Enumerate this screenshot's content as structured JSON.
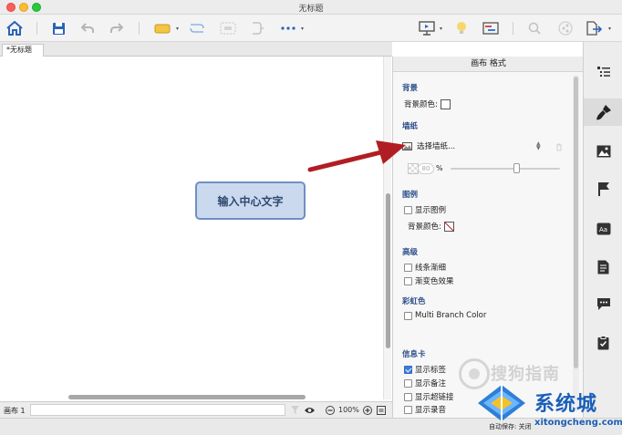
{
  "window": {
    "title": "无标题"
  },
  "document_tab": {
    "label": "*无标题"
  },
  "central_topic": {
    "text": "输入中心文字"
  },
  "statusbar": {
    "sheet_label": "画布 1",
    "zoom": "100%"
  },
  "format_panel": {
    "title": "画布 格式",
    "background": {
      "heading": "背景",
      "color_label": "背景颜色:"
    },
    "wallpaper": {
      "heading": "墙纸",
      "select_label": "选择墙纸...",
      "opacity_value": "80",
      "opacity_unit": "%",
      "opacity_fraction": 0.6
    },
    "legend": {
      "heading": "图例",
      "show_legend": "显示图例",
      "show_legend_checked": false,
      "bg_color_label": "背景颜色:"
    },
    "advanced": {
      "heading": "高级",
      "taper_lines": "线条渐细",
      "taper_lines_checked": false,
      "gradient": "渐变色效果",
      "gradient_checked": false
    },
    "rainbow": {
      "heading": "彩虹色",
      "multi_branch": "Multi Branch Color",
      "multi_branch_checked": false
    },
    "info_card": {
      "heading": "信息卡",
      "items": [
        {
          "label": "显示标签",
          "checked": true
        },
        {
          "label": "显示备注",
          "checked": false
        },
        {
          "label": "显示超链接",
          "checked": false
        },
        {
          "label": "显示录音",
          "checked": false
        }
      ]
    }
  },
  "bottom_bar": {
    "text": "自动保存: 关闭"
  },
  "watermark": {
    "faint_text": "搜狗指南",
    "brand": "系统城",
    "url": "xitongcheng.com"
  },
  "icons": {
    "toolbar": [
      "home-icon",
      "save-icon",
      "undo-icon",
      "redo-icon",
      "insert-topic-icon",
      "relationship-icon",
      "boundary-icon",
      "summary-icon",
      "more-icon",
      "presentation-icon",
      "idea-icon",
      "gantt-icon",
      "search-icon",
      "share-icon",
      "export-icon"
    ],
    "rightbar": [
      "outline-icon",
      "format-brush-icon",
      "image-icon",
      "marker-flag-icon",
      "text-style-icon",
      "notes-icon",
      "comments-icon",
      "task-icon"
    ]
  },
  "colors": {
    "accent": "#3a7fd9",
    "section_heading": "#2d4e8a",
    "topic_fill": "#cbd9ee",
    "topic_border": "#6f8fc4",
    "arrow": "#b01e23"
  }
}
